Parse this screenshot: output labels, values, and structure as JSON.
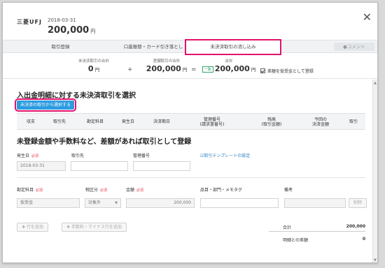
{
  "header": {
    "bank_name": "三菱UFJ",
    "date": "2018-03-31",
    "amount": "200,000",
    "currency": "円",
    "close_icon": "close-icon"
  },
  "tabs": [
    {
      "label": "取引登録"
    },
    {
      "label": "口座振替・カード引き落とし"
    },
    {
      "label": "未決済取引の消し込み",
      "active": true
    }
  ],
  "comment_button": {
    "label": "●コメント"
  },
  "summary": {
    "unsettled_label": "未決済取引の合計",
    "unsettled_value": "0",
    "diff_label": "差額取引の合計",
    "diff_value": "200,000",
    "total_label": "合計",
    "total_badge": "一致",
    "total_value": "200,000",
    "unit": "円",
    "plus": "+",
    "equals": "=",
    "checkbox_label": "差額を仮受金として登録",
    "checkbox_checked": true
  },
  "section1": {
    "title": "入出金明細に対する未決済取引を選択",
    "select_button": "未決済の取引から選択する",
    "columns": [
      "収支",
      "取引先",
      "勘定科目",
      "発生日",
      "決済期日",
      "管理番号\n(請求書番号)",
      "残高\n(取引金額)",
      "今回の\n決済金額",
      "取引"
    ]
  },
  "section2": {
    "title": "未登録金額や手数料など、差額があれば取引として登録",
    "date_label": "発生日",
    "required": "必須",
    "date_value": "2018-03-31",
    "partner_label": "取引先",
    "mgmt_label": "管理番号",
    "template_link": "☑取引テンプレートの設定",
    "account_label": "勘定科目",
    "tax_label": "税区分",
    "amount_label": "金額",
    "items_label": "品目・部門・メモタグ",
    "memo_label": "備考",
    "account_value": "仮受金",
    "tax_value": "対象外",
    "amount_value": "200,000",
    "delete_label": "削除",
    "add_row": "✚ 行を追加",
    "add_fee": "✚ 手数料・マイナス行を追加",
    "total_label": "合計",
    "total_value": "200,000",
    "diff_label": "明細との差額",
    "diff_value": "0"
  },
  "colors": {
    "accent": "#2c9be0",
    "highlight": "#e3136c",
    "required": "#e8394a"
  }
}
